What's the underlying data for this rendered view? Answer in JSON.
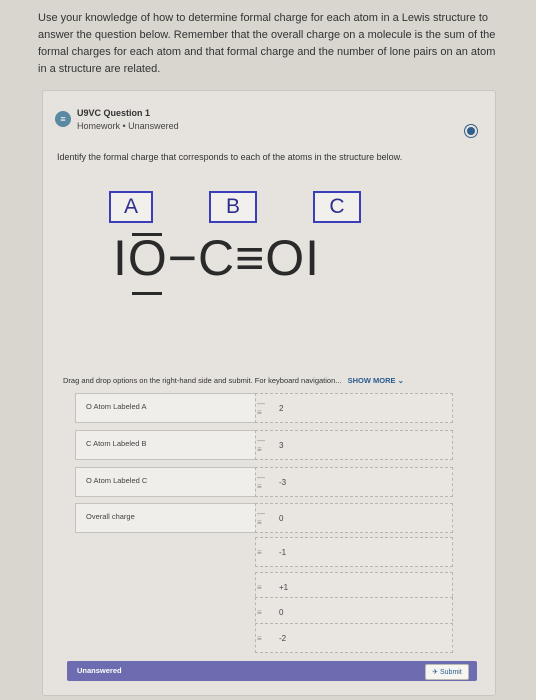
{
  "intro_text": "Use your knowledge of how to determine formal charge for each atom in a Lewis structure to answer the question below. Remember that the overall charge on a molecule is the sum of the formal charges for each atom and that formal charge and the number of lone pairs on an atom in a structure are related.",
  "question": {
    "icon": "question-icon",
    "title": "U9VC Question 1",
    "subtitle": "Homework • Unanswered",
    "prompt": "Identify the formal charge that corresponds to each of the atoms in the structure below.",
    "labels": [
      "A",
      "B",
      "C"
    ],
    "structure_text": "IO−C≡OI"
  },
  "instructions": {
    "text": "Drag and drop options on the right-hand side and submit. For keyboard navigation...",
    "more": "SHOW MORE ⌄"
  },
  "drop_rows": [
    "O Atom Labeled A",
    "C Atom Labeled B",
    "O Atom Labeled C",
    "Overall charge"
  ],
  "options": [
    "2",
    "3",
    "-3",
    "0",
    "-1",
    "+1",
    "0",
    "-2"
  ],
  "status": {
    "label": "Unanswered",
    "submit": "Submit"
  },
  "colors": {
    "label_border": "#3c3db8",
    "status_bar": "#6d6cb0"
  }
}
